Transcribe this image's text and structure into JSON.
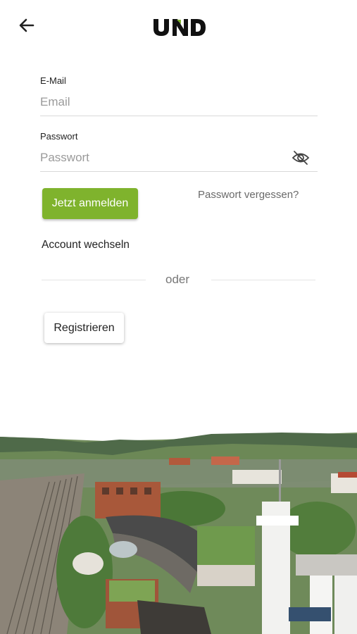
{
  "header": {
    "back_icon": "arrow-left-icon",
    "logo_text": "UND"
  },
  "form": {
    "email_label": "E-Mail",
    "email_placeholder": "Email",
    "email_value": "",
    "password_label": "Passwort",
    "password_placeholder": "Passwort",
    "password_value": "",
    "password_toggle_icon": "eye-off-icon"
  },
  "actions": {
    "login_label": "Jetzt anmelden",
    "forgot_label": "Passwort vergessen?",
    "switch_account_label": "Account wechseln",
    "divider_label": "oder",
    "register_label": "Registrieren"
  },
  "colors": {
    "accent": "#7fb32d",
    "text": "#222222",
    "muted": "#9a9a9a"
  },
  "image": {
    "description_icon": "aerial-photo-campus"
  }
}
